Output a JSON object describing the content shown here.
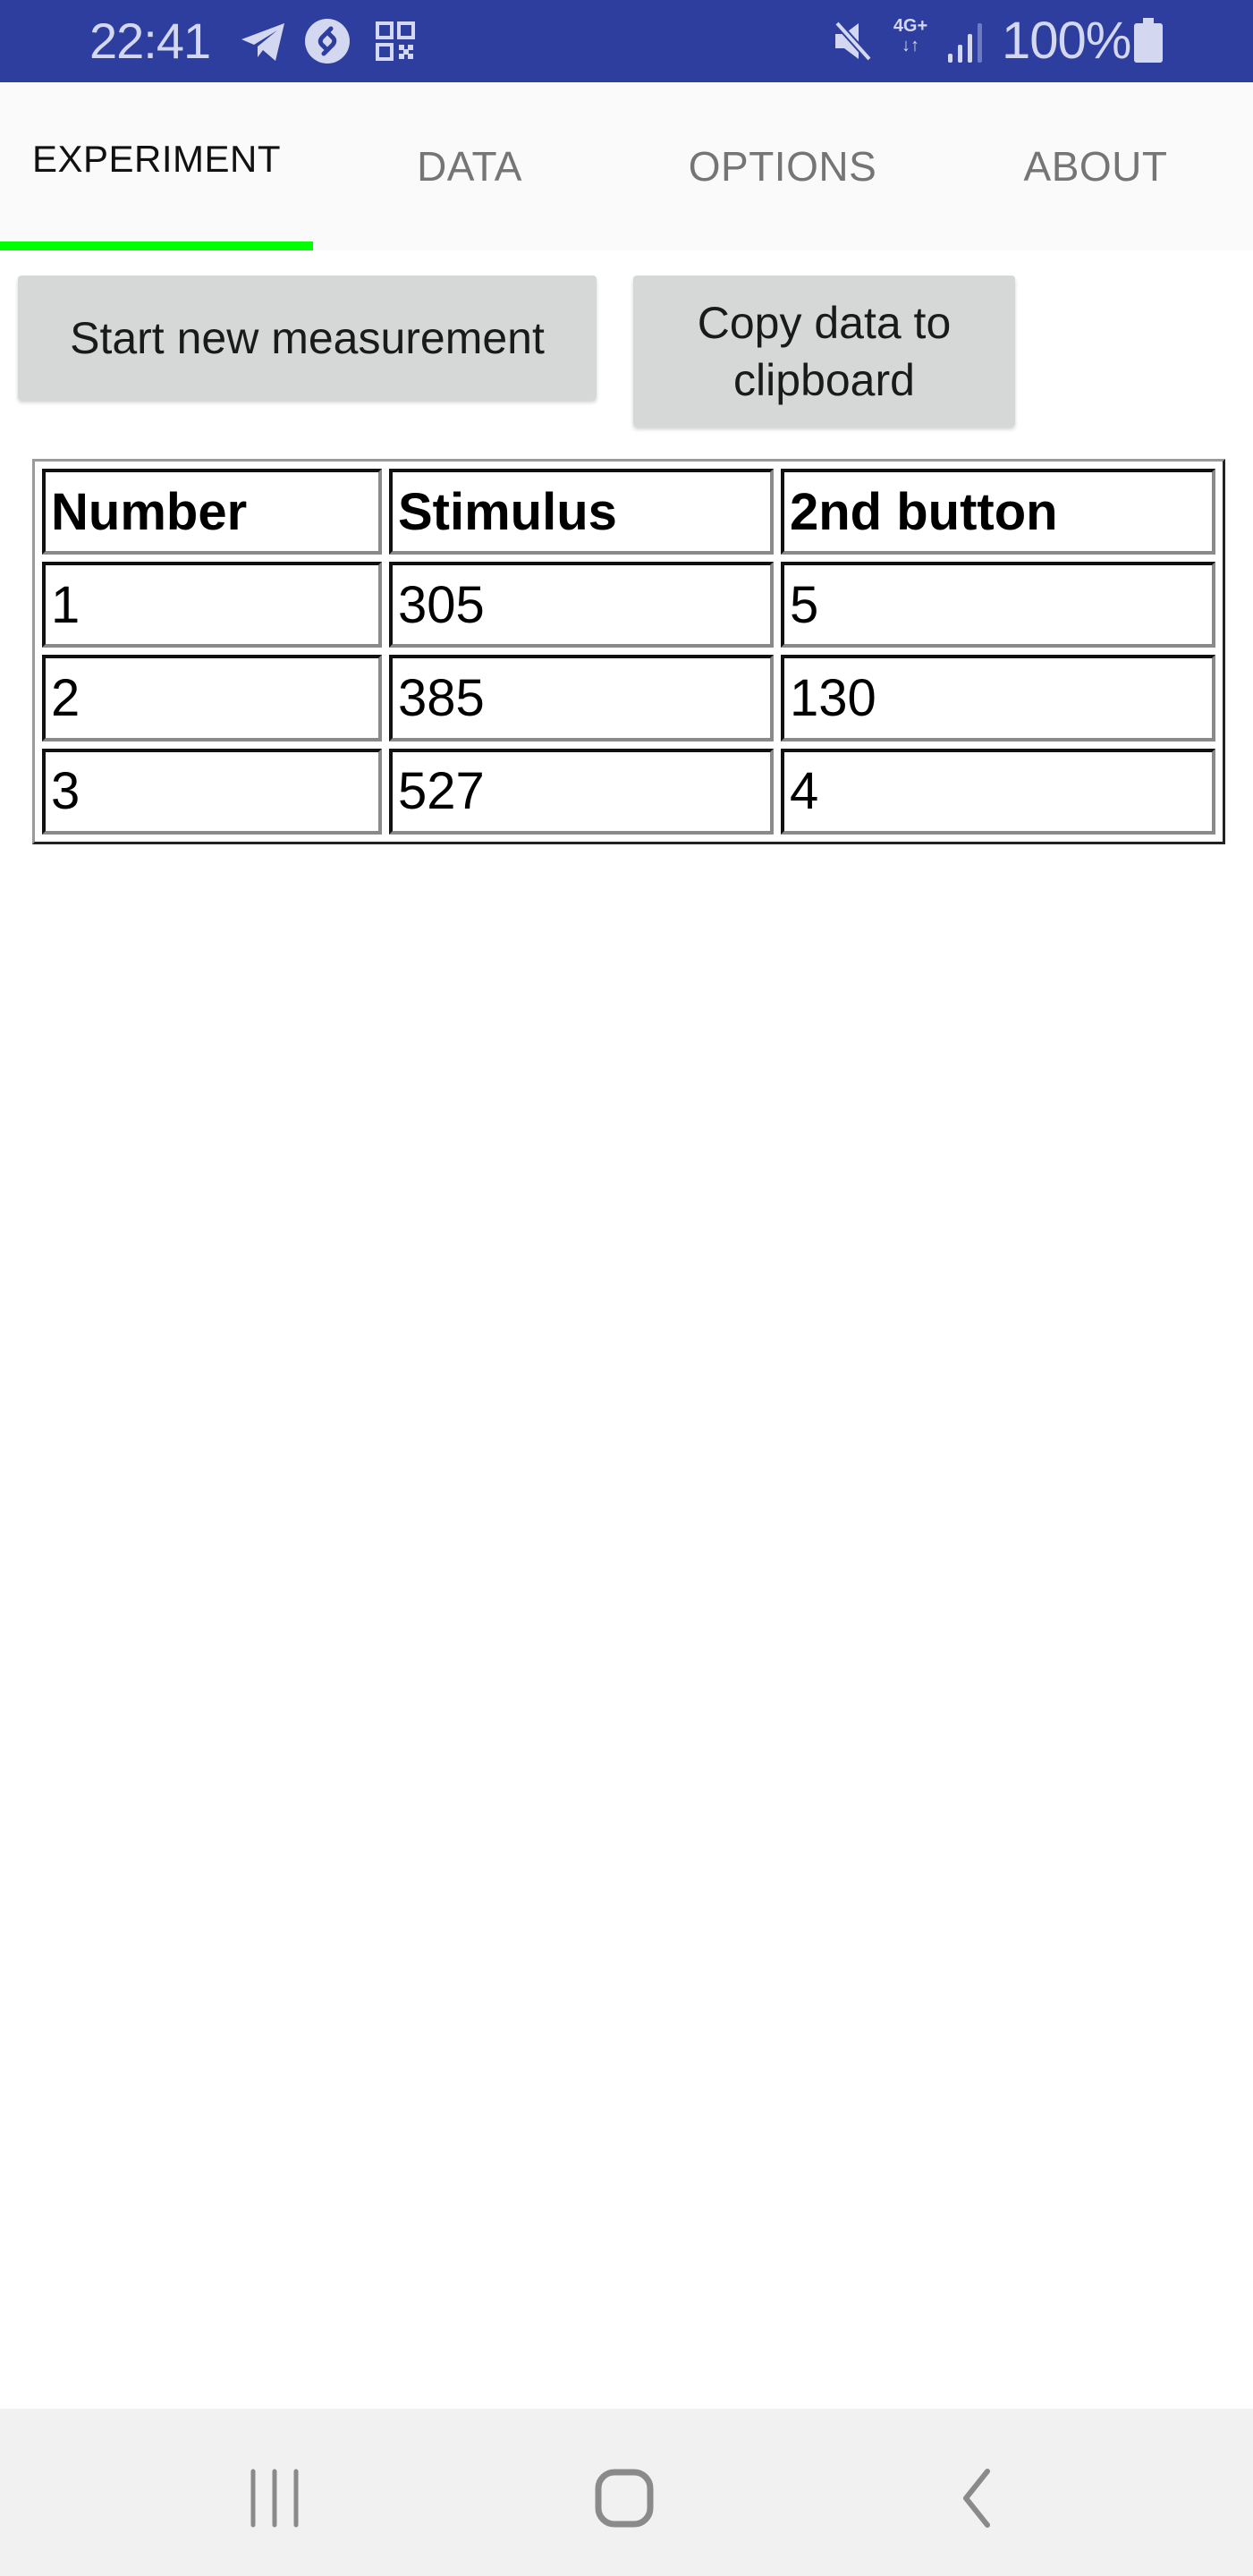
{
  "status_bar": {
    "time": "22:41",
    "left_icons": [
      "telegram-icon",
      "shazam-icon",
      "qr-code-icon"
    ],
    "right_icons": [
      "mute-icon",
      "network-4g-plus-icon",
      "signal-icon",
      "battery-icon"
    ],
    "network_label": "4G+",
    "battery_text": "100%",
    "background_color": "#2E3E9E"
  },
  "tabs": [
    {
      "label": "EXPERIMENT",
      "active": true
    },
    {
      "label": "DATA",
      "active": false
    },
    {
      "label": "OPTIONS",
      "active": false
    },
    {
      "label": "ABOUT",
      "active": false
    }
  ],
  "tab_indicator_color": "#00FF00",
  "actions": {
    "start_label": "Start new measurement",
    "copy_label_line1": "Copy data to",
    "copy_label_line2": "clipboard"
  },
  "table": {
    "headers": [
      "Number",
      "Stimulus",
      "2nd button"
    ],
    "rows": [
      [
        "1",
        "305",
        "5"
      ],
      [
        "2",
        "385",
        "130"
      ],
      [
        "3",
        "527",
        "4"
      ]
    ]
  },
  "nav_bar": {
    "buttons": [
      "recents",
      "home",
      "back"
    ]
  }
}
